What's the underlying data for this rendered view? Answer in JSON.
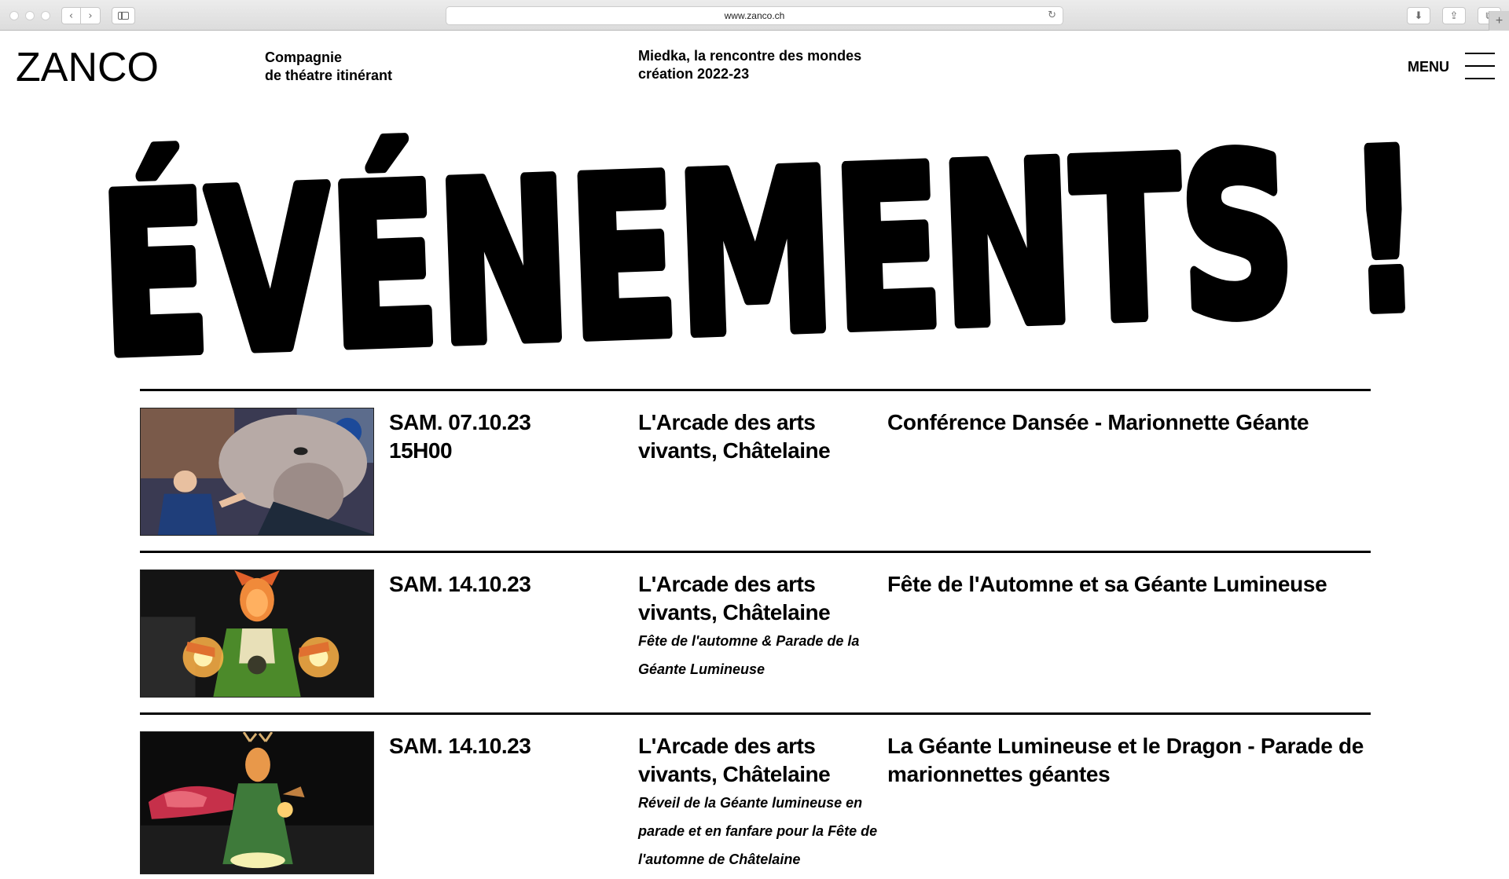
{
  "browser": {
    "url": "www.zanco.ch",
    "new_tab_symbol": "+"
  },
  "site": {
    "logo": "ZANCO",
    "tagline_line1": "Compagnie",
    "tagline_line2": "de théatre itinérant",
    "production_line1": "Miedka, la rencontre des mondes",
    "production_line2": "création 2022-23",
    "menu_label": "MENU"
  },
  "page_title": "ÉVÉNEMENTS !",
  "events": [
    {
      "date": "SAM. 07.10.23",
      "time": "15H00",
      "venue": "L'Arcade des arts vivants, Châtelaine",
      "note": "",
      "title": "Conférence Dansée - Marionnette Géante",
      "image_subject": "giant ram puppet head with puppeteer"
    },
    {
      "date": "SAM. 14.10.23",
      "time": "",
      "venue": "L'Arcade des arts vivants, Châtelaine",
      "note": "Fête de l'automne & Parade de la Géante Lumineuse",
      "title": "Fête de l'Automne et sa Géante Lumineuse",
      "image_subject": "illuminated giant lantern puppet"
    },
    {
      "date": "SAM. 14.10.23",
      "time": "",
      "venue": "L'Arcade des arts vivants, Châtelaine",
      "note": "Réveil de la Géante lumineuse en parade et en fanfare pour la Fête de l'automne de Châtelaine",
      "title": "La Géante Lumineuse et le Dragon - Parade de marionnettes géantes",
      "image_subject": "giant lantern puppet with dragon at night parade"
    }
  ],
  "colors": {
    "text": "#000000",
    "background": "#ffffff",
    "chrome": "#e4e4e4"
  }
}
